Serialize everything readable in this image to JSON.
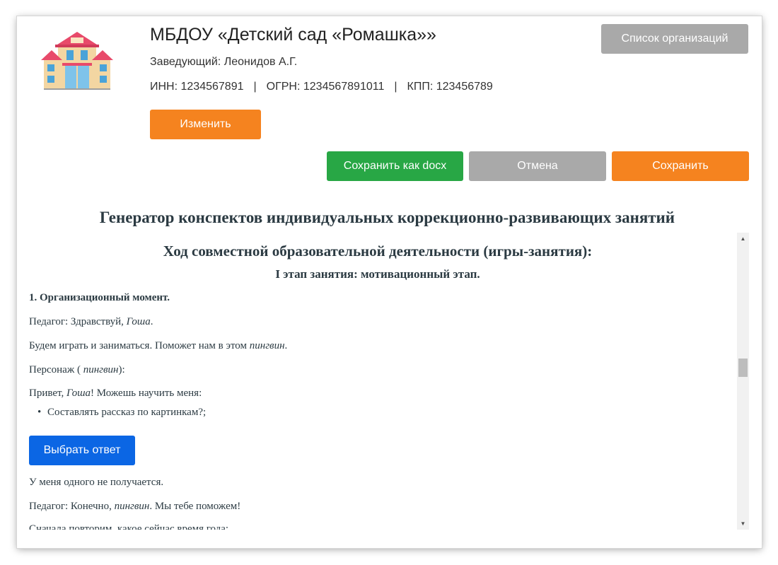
{
  "org": {
    "name": "МБДОУ «Детский сад «Ромашка»»",
    "head": "Заведующий: Леонидов А.Г.",
    "inn": "ИНН: 1234567891",
    "sep": "|",
    "ogrn": "ОГРН: 1234567891011",
    "kpp": "КПП: 123456789"
  },
  "buttons": {
    "org_list": "Список организаций",
    "edit": "Изменить",
    "save_docx": "Сохранить как docx",
    "cancel": "Отмена",
    "save": "Сохранить",
    "choose_answer": "Выбрать ответ"
  },
  "generator_title": "Генератор конспектов индивидуальных коррекционно-развивающих занятий",
  "content": {
    "course_heading": "Ход совместной образовательной деятельности (игры-занятия):",
    "stage_heading": "I этап занятия: мотивационный этап.",
    "section1": "1. Организационный момент.",
    "l1_a": "Педагог: Здравствуй, ",
    "child": "Гоша",
    "dot": ".",
    "l2_a": "Будем играть и заниматься. Поможет нам в этом ",
    "character": "пингвин",
    "l3_a": "Персонаж ( ",
    "l3_b": "):",
    "l4_a": "Привет, ",
    "l4_b": "! Можешь научить меня:",
    "bullet1": "Составлять рассказ по картинкам?;",
    "l5": "У меня одного не получается.",
    "l6_a": "Педагог: Конечно, ",
    "l6_b": ". Мы тебе поможем!",
    "l7": "Сначала повторим, какое сейчас время года:"
  },
  "icons": {
    "logo": "kindergarten-building-icon",
    "scroll_up": "scroll-up-arrow-icon",
    "scroll_down": "scroll-down-arrow-icon"
  },
  "colors": {
    "orange": "#f5831f",
    "green": "#28a745",
    "gray": "#a9a9a9",
    "blue": "#0b66e4"
  }
}
